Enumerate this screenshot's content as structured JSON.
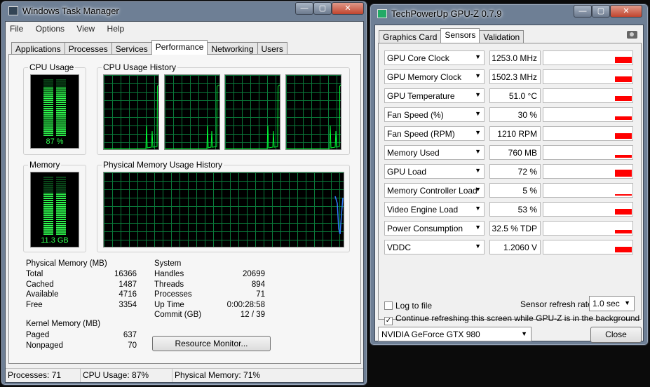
{
  "task_manager": {
    "title": "Windows Task Manager",
    "menu": [
      "File",
      "Options",
      "View",
      "Help"
    ],
    "tabs": [
      "Applications",
      "Processes",
      "Services",
      "Performance",
      "Networking",
      "Users"
    ],
    "active_tab": "Performance",
    "cpu_usage": {
      "label": "CPU Usage",
      "value": "87 %",
      "level": 0.87
    },
    "cpu_history": {
      "label": "CPU Usage History",
      "cores": 4
    },
    "memory": {
      "label": "Memory",
      "value": "11.3 GB",
      "level": 0.71
    },
    "memory_history": {
      "label": "Physical Memory Usage History"
    },
    "physical_memory": {
      "label": "Physical Memory (MB)",
      "rows": [
        {
          "name": "Total",
          "value": "16366"
        },
        {
          "name": "Cached",
          "value": "1487"
        },
        {
          "name": "Available",
          "value": "4716"
        },
        {
          "name": "Free",
          "value": "3354"
        }
      ]
    },
    "kernel_memory": {
      "label": "Kernel Memory (MB)",
      "rows": [
        {
          "name": "Paged",
          "value": "637"
        },
        {
          "name": "Nonpaged",
          "value": "70"
        }
      ]
    },
    "system": {
      "label": "System",
      "rows": [
        {
          "name": "Handles",
          "value": "20699"
        },
        {
          "name": "Threads",
          "value": "894"
        },
        {
          "name": "Processes",
          "value": "71"
        },
        {
          "name": "Up Time",
          "value": "0:00:28:58"
        },
        {
          "name": "Commit (GB)",
          "value": "12 / 39"
        }
      ]
    },
    "resource_monitor_button": "Resource Monitor...",
    "status": {
      "processes": "Processes: 71",
      "cpu": "CPU Usage: 87%",
      "memory": "Physical Memory: 71%"
    },
    "colors": {
      "graph_line": "#00ff33",
      "memory_line": "#2f7bff",
      "grid": "#0a7a3a"
    }
  },
  "gpuz": {
    "title": "TechPowerUp GPU-Z 0.7.9",
    "tabs": [
      "Graphics Card",
      "Sensors",
      "Validation"
    ],
    "active_tab": "Sensors",
    "sensors": [
      {
        "name": "GPU Core Clock",
        "value": "1253.0 MHz",
        "level": 0.6
      },
      {
        "name": "GPU Memory Clock",
        "value": "1502.3 MHz",
        "level": 0.55
      },
      {
        "name": "GPU Temperature",
        "value": "51.0 °C",
        "level": 0.45
      },
      {
        "name": "Fan Speed (%)",
        "value": "30 %",
        "level": 0.3
      },
      {
        "name": "Fan Speed (RPM)",
        "value": "1210 RPM",
        "level": 0.5
      },
      {
        "name": "Memory Used",
        "value": "760 MB",
        "level": 0.2
      },
      {
        "name": "GPU Load",
        "value": "72 %",
        "level": 0.72
      },
      {
        "name": "Memory Controller Load",
        "value": "5 %",
        "level": 0.05
      },
      {
        "name": "Video Engine Load",
        "value": "53 %",
        "level": 0.53
      },
      {
        "name": "Power Consumption",
        "value": "32.5 % TDP",
        "level": 0.33
      },
      {
        "name": "VDDC",
        "value": "1.2060 V",
        "level": 0.5
      }
    ],
    "log_to_file": "Log to file",
    "log_checked": false,
    "refresh_label": "Sensor refresh rate:",
    "refresh_value": "1.0 sec",
    "continue_label": "Continue refreshing this screen while GPU-Z is in the background",
    "continue_checked": true,
    "gpu_select": "NVIDIA GeForce GTX 980",
    "close_button": "Close",
    "colors": {
      "sensor_bar": "#ff0000"
    }
  }
}
